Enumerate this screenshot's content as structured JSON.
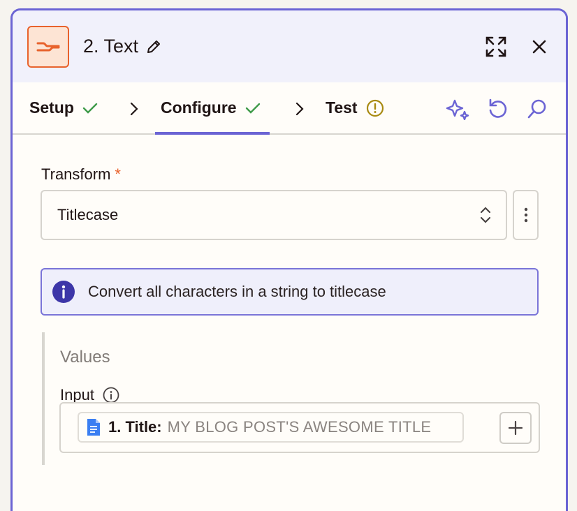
{
  "header": {
    "title": "2. Text",
    "icons": {
      "app": "text-formatter-icon",
      "edit": "pencil-icon",
      "expand": "expand-icon",
      "close": "close-icon"
    }
  },
  "tabs": [
    {
      "label": "Setup",
      "status": "complete"
    },
    {
      "label": "Configure",
      "status": "complete",
      "active": true
    },
    {
      "label": "Test",
      "status": "warning"
    }
  ],
  "toolbar": {
    "icons": [
      "sparkle-icon",
      "refresh-icon",
      "search-icon"
    ]
  },
  "form": {
    "transform": {
      "label": "Transform",
      "required_mark": "*",
      "value": "Titlecase"
    },
    "info_text": "Convert all characters in a string to titlecase",
    "values_group": {
      "title": "Values",
      "input": {
        "label": "Input",
        "pill_label": "1. Title:",
        "pill_value": "MY BLOG POST'S AWESOME TITLE"
      }
    }
  },
  "colors": {
    "accent": "#6b64d4",
    "brand": "#e8622c",
    "success": "#3f9b4a",
    "warning": "#a88a12"
  }
}
